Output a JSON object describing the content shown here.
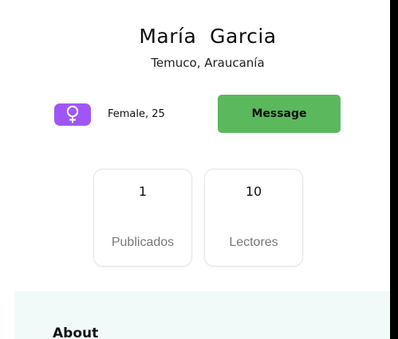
{
  "profile": {
    "name": "María  Garcia",
    "location": "Temuco, Araucanía",
    "gender_age": "Female, 25",
    "gender_icon": "female-symbol-icon"
  },
  "actions": {
    "message_label": "Message"
  },
  "stats": [
    {
      "value": "1",
      "label": "Publicados"
    },
    {
      "value": "10",
      "label": "Lectores"
    }
  ],
  "about": {
    "title": "About"
  },
  "colors": {
    "badge_bg": "#a056f5",
    "message_bg": "#5cb85c",
    "about_bg": "#f2f9f9"
  }
}
